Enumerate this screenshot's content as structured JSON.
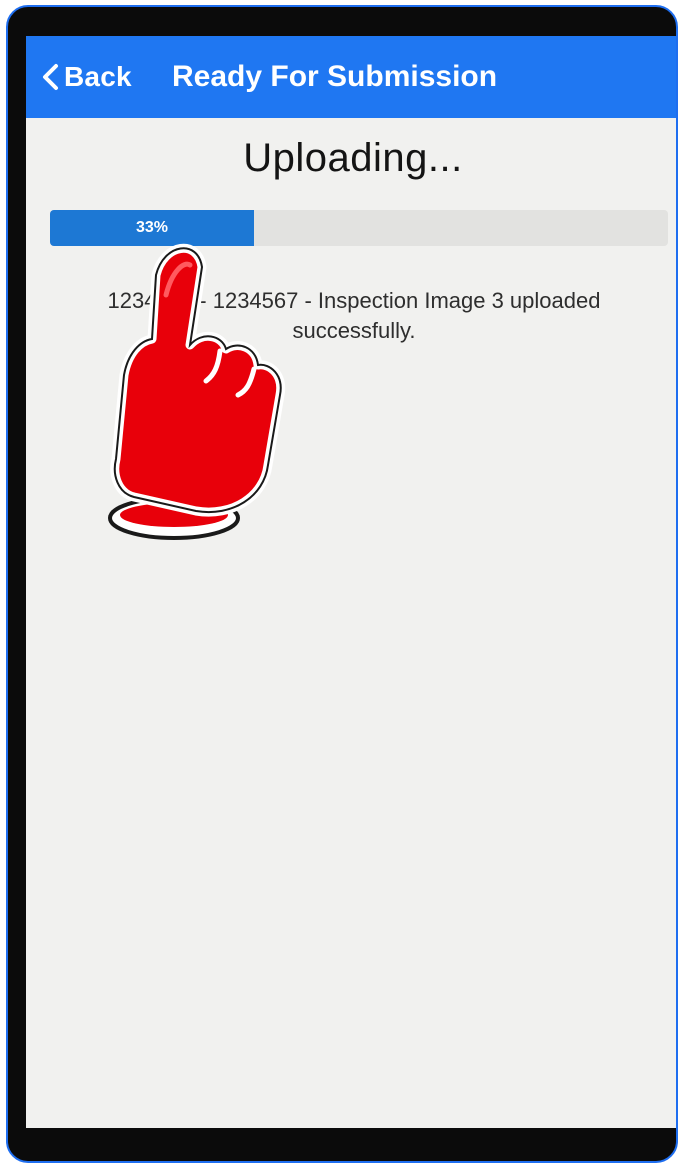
{
  "nav": {
    "back_label": "Back",
    "title": "Ready For Submission"
  },
  "upload": {
    "heading": "Uploading...",
    "progress": {
      "percent": 33,
      "label": "33%"
    },
    "message": "1234567 - 1234567 - Inspection Image 3 uploaded successfully."
  },
  "icons": {
    "back": "chevron-left-icon",
    "pointer": "pointing-hand-icon"
  },
  "colors": {
    "nav_bar": "#1f77f2",
    "progress_fill": "#1d78d4",
    "progress_track": "#e2e2e0",
    "frame_border": "#1e6ef0",
    "pointer_fill": "#e8000a"
  }
}
